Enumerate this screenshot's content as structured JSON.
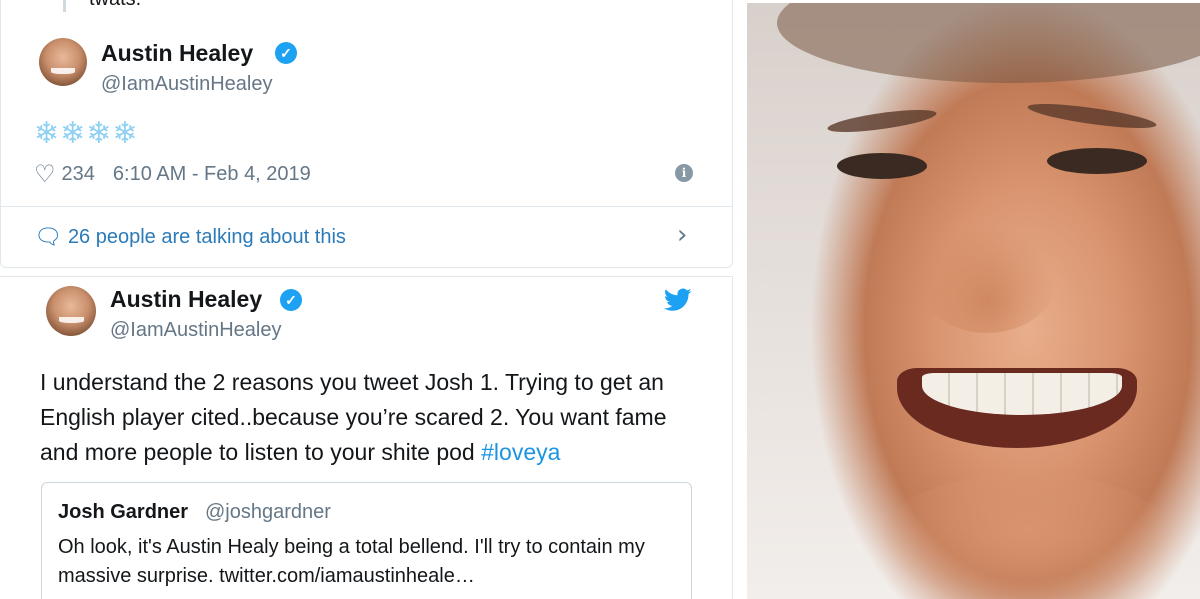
{
  "top_tweet": {
    "previous_text": "twats.",
    "author_name": "Austin Healey",
    "author_handle": "@IamAustinHealey",
    "body": "❄❄❄❄",
    "likes": "234",
    "timestamp": "6:10 AM - Feb 4, 2019",
    "talking_text": "26 people are talking about this"
  },
  "bottom_tweet": {
    "author_name": "Austin Healey",
    "author_handle": "@IamAustinHealey",
    "body_text": "I understand the 2 reasons you tweet Josh 1. Trying to get an English player cited..because you’re scared 2. You want fame and more people to listen to your shite pod ",
    "hashtag": "#loveya",
    "quoted": {
      "author_name": "Josh Gardner",
      "author_handle": "@joshgardner",
      "text": "Oh look, it's Austin Healy being a total bellend. I'll try to contain my massive surprise. twitter.com/iamaustinheale…"
    }
  },
  "icons": {
    "verified": "verified-badge-icon",
    "like": "heart-icon",
    "info": "info-icon",
    "reply": "speech-bubble-icon",
    "chevron": "chevron-right-icon",
    "brand": "twitter-bird-icon"
  },
  "colors": {
    "twitter_blue": "#1da1f2",
    "link_blue": "#2b7bb9",
    "muted": "#657786"
  }
}
